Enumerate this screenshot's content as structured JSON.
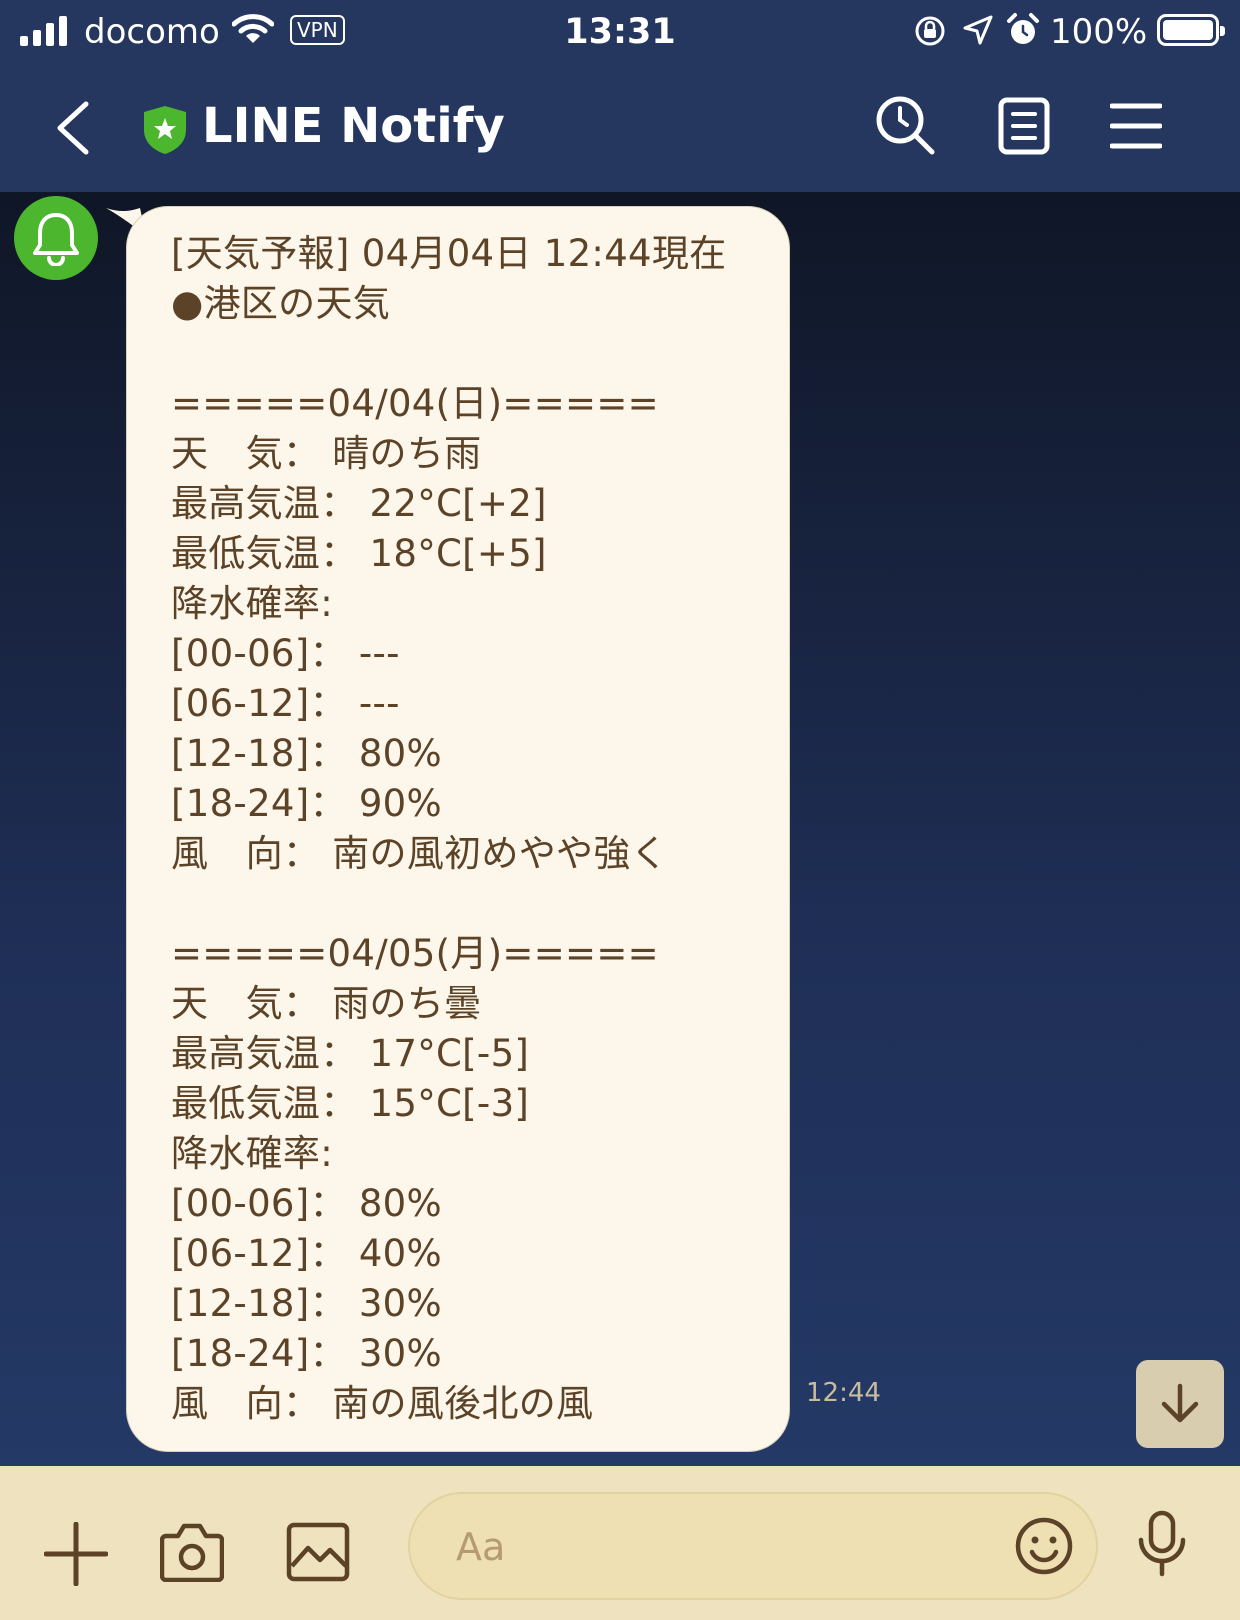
{
  "status_bar": {
    "carrier": "docomo",
    "vpn": "VPN",
    "time": "13:31",
    "battery": "100%",
    "icons": [
      "signal-icon",
      "wifi-icon",
      "orientation-lock-icon",
      "location-icon",
      "alarm-icon",
      "battery-icon"
    ]
  },
  "header": {
    "title": "LINE Notify",
    "icons": [
      "back-icon",
      "shield-star-icon",
      "search-icon",
      "notes-icon",
      "menu-icon"
    ]
  },
  "chat": {
    "message_lines": [
      "[天気予報] 04月04日 12:44現在",
      "●港区の天気",
      "",
      "=====04/04(日)=====",
      "天　気： 晴のち雨",
      "最高気温： 22°C[+2]",
      "最低気温： 18°C[+5]",
      "降水確率:",
      "[00-06]： ---",
      "[06-12]： ---",
      "[12-18]： 80%",
      "[18-24]： 90%",
      "風　向： 南の風初めやや強く",
      "",
      "=====04/05(月)=====",
      "天　気： 雨のち曇",
      "最高気温： 17°C[-5]",
      "最低気温： 15°C[-3]",
      "降水確率:",
      "[00-06]： 80%",
      "[06-12]： 40%",
      "[12-18]： 30%",
      "[18-24]： 30%",
      "風　向： 南の風後北の風"
    ],
    "timestamp": "12:44"
  },
  "input_bar": {
    "placeholder": "Aa",
    "icons": [
      "plus-icon",
      "camera-icon",
      "image-icon",
      "emoji-icon",
      "microphone-icon"
    ]
  },
  "colors": {
    "header_bg": "#25375f",
    "bubble_bg": "#fcf7ea",
    "bubble_text": "#5c4227",
    "avatar_green": "#4cb62f",
    "input_bar_bg": "#efe3bf"
  }
}
